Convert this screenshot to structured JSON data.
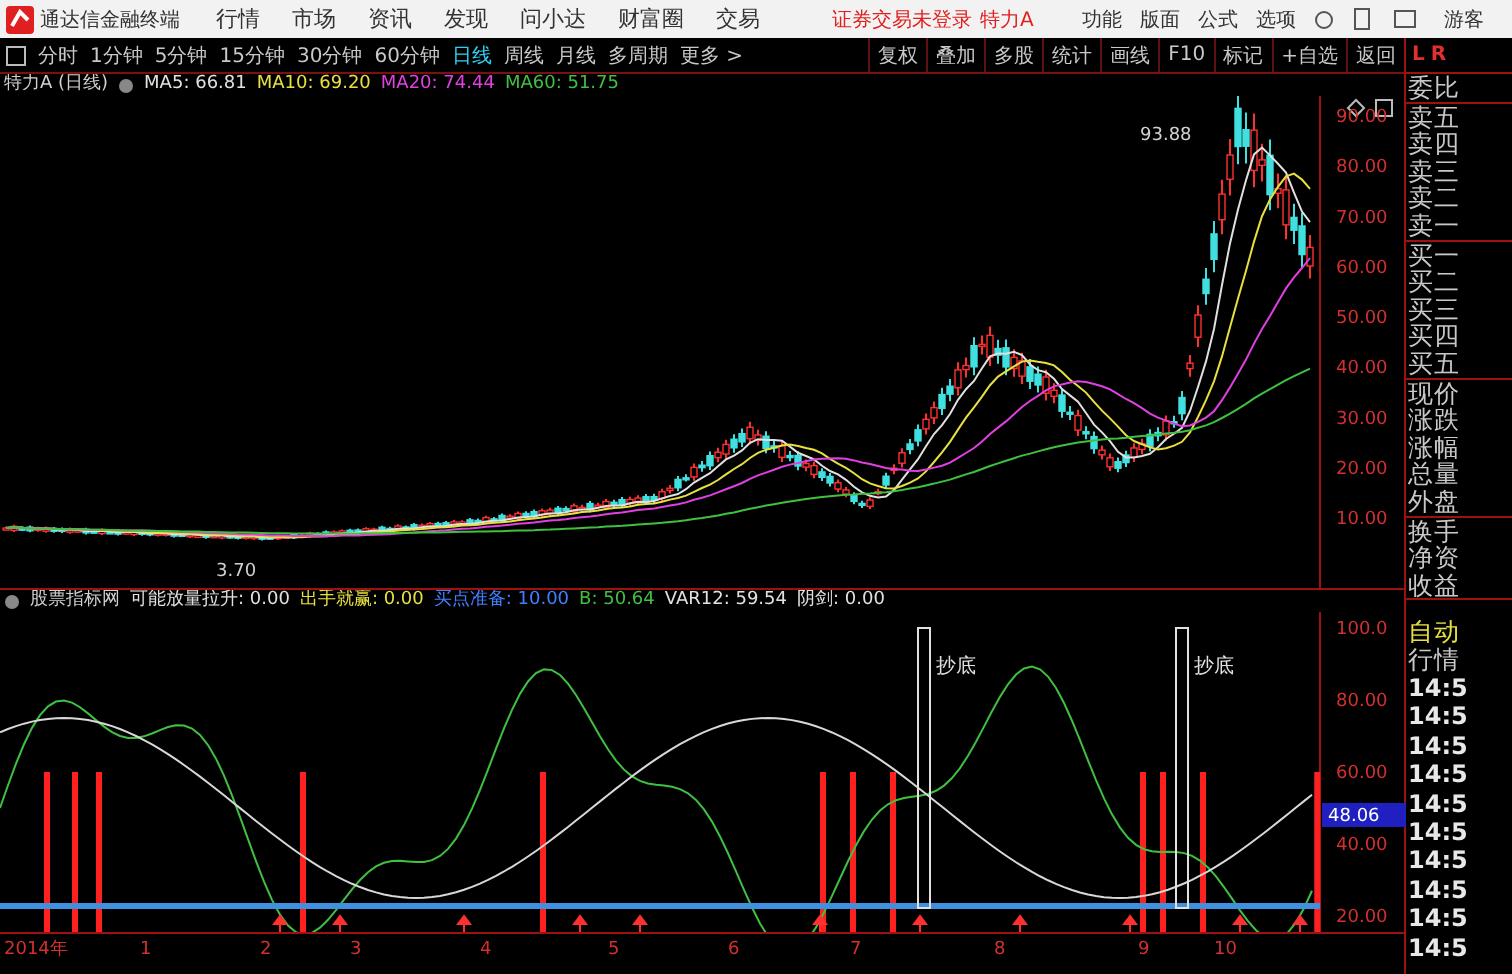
{
  "title_bar": {
    "app_name": "通达信金融终端",
    "menus": [
      "行情",
      "市场",
      "资讯",
      "发现",
      "问小达",
      "财富圈",
      "交易"
    ],
    "notice": "证券交易未登录",
    "stock": "特力A",
    "tools": [
      "功能",
      "版面",
      "公式",
      "选项"
    ],
    "user": "游客"
  },
  "toolbar": {
    "periods": [
      {
        "label": "分时",
        "selected": false
      },
      {
        "label": "1分钟",
        "selected": false
      },
      {
        "label": "5分钟",
        "selected": false
      },
      {
        "label": "15分钟",
        "selected": false
      },
      {
        "label": "30分钟",
        "selected": false
      },
      {
        "label": "60分钟",
        "selected": false
      },
      {
        "label": "日线",
        "selected": true
      },
      {
        "label": "周线",
        "selected": false
      },
      {
        "label": "月线",
        "selected": false
      },
      {
        "label": "多周期",
        "selected": false
      },
      {
        "label": "更多 >",
        "selected": false
      }
    ],
    "actions": [
      "复权",
      "叠加",
      "多股",
      "统计",
      "画线",
      "F10",
      "标记",
      "+自选",
      "返回"
    ]
  },
  "price_pane": {
    "title": "特力A (日线)",
    "ma": [
      {
        "label": "MA5: 66.81",
        "color": "#e0e0e0"
      },
      {
        "label": "MA10: 69.20",
        "color": "#e8e040"
      },
      {
        "label": "MA20: 74.44",
        "color": "#e040e0"
      },
      {
        "label": "MA60: 51.75",
        "color": "#40c040"
      }
    ],
    "high_label": "93.88",
    "low_label": "3.70",
    "y_ticks": [
      "90.00",
      "80.00",
      "70.00",
      "60.00",
      "50.00",
      "40.00",
      "30.00",
      "20.00",
      "10.00"
    ]
  },
  "indicator_pane": {
    "name": "股票指标网",
    "values": [
      {
        "label": "可能放量拉升: 0.00",
        "color": "#e0e0e0"
      },
      {
        "label": "出手就赢: 0.00",
        "color": "#e8e040"
      },
      {
        "label": "买点准备: 10.00",
        "color": "#4080ff"
      },
      {
        "label": "B: 50.64",
        "color": "#40c040"
      },
      {
        "label": "VAR12: 59.54",
        "color": "#e0e0e0"
      },
      {
        "label": "阴剑: 0.00",
        "color": "#e0e0e0"
      }
    ],
    "signals": [
      "抄底",
      "抄底"
    ],
    "y_ticks": [
      "100.0",
      "80.00",
      "60.00",
      "40.00",
      "20.00"
    ],
    "current": "48.06"
  },
  "date_axis": [
    "2014年",
    "1",
    "2",
    "3",
    "4",
    "5",
    "6",
    "7",
    "8",
    "9",
    "10"
  ],
  "quote_panel": {
    "corner": [
      "L",
      "R"
    ],
    "groups": [
      [
        "委比"
      ],
      [
        "卖五",
        "卖四",
        "卖三",
        "卖二",
        "卖一"
      ],
      [
        "买一",
        "买二",
        "买三",
        "买四",
        "买五"
      ],
      [
        "现价",
        "涨跌",
        "涨幅",
        "总量",
        "外盘"
      ],
      [
        "换手",
        "净资",
        "收益"
      ]
    ],
    "ticker_mode": "自动",
    "ticker_title": "行情",
    "ticks": [
      "14:5",
      "14:5",
      "14:5",
      "14:5",
      "14:5",
      "14:5",
      "14:5",
      "14:5",
      "14:5",
      "14:5"
    ]
  }
}
